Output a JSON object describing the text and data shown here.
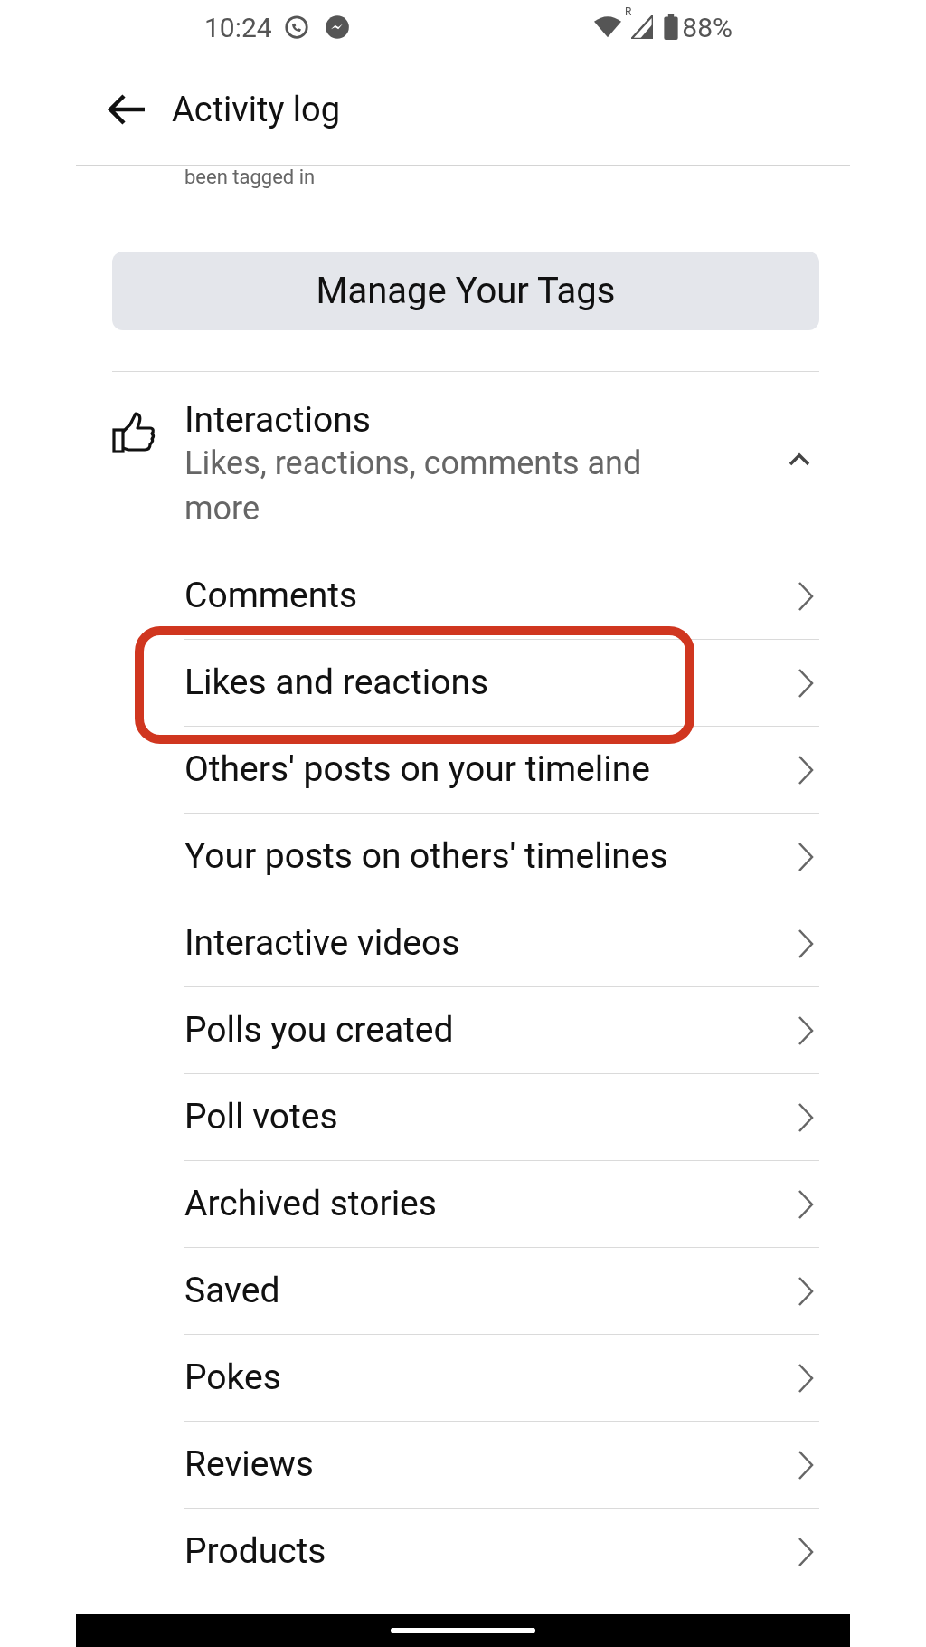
{
  "status_bar": {
    "time": "10:24",
    "roaming": "R",
    "battery": "88%"
  },
  "header": {
    "title": "Activity log"
  },
  "previous_item_subtitle": "been tagged in",
  "manage_button": "Manage Your Tags",
  "section": {
    "title": "Interactions",
    "subtitle": "Likes, reactions, comments and more",
    "expanded": true,
    "items": [
      {
        "label": "Comments",
        "highlighted": false
      },
      {
        "label": "Likes and reactions",
        "highlighted": true
      },
      {
        "label": "Others' posts on your timeline",
        "highlighted": false
      },
      {
        "label": "Your posts on others' timelines",
        "highlighted": false
      },
      {
        "label": "Interactive videos",
        "highlighted": false
      },
      {
        "label": "Polls you created",
        "highlighted": false
      },
      {
        "label": "Poll votes",
        "highlighted": false
      },
      {
        "label": "Archived stories",
        "highlighted": false
      },
      {
        "label": "Saved",
        "highlighted": false
      },
      {
        "label": "Pokes",
        "highlighted": false
      },
      {
        "label": "Reviews",
        "highlighted": false
      },
      {
        "label": "Products",
        "highlighted": false
      }
    ]
  }
}
